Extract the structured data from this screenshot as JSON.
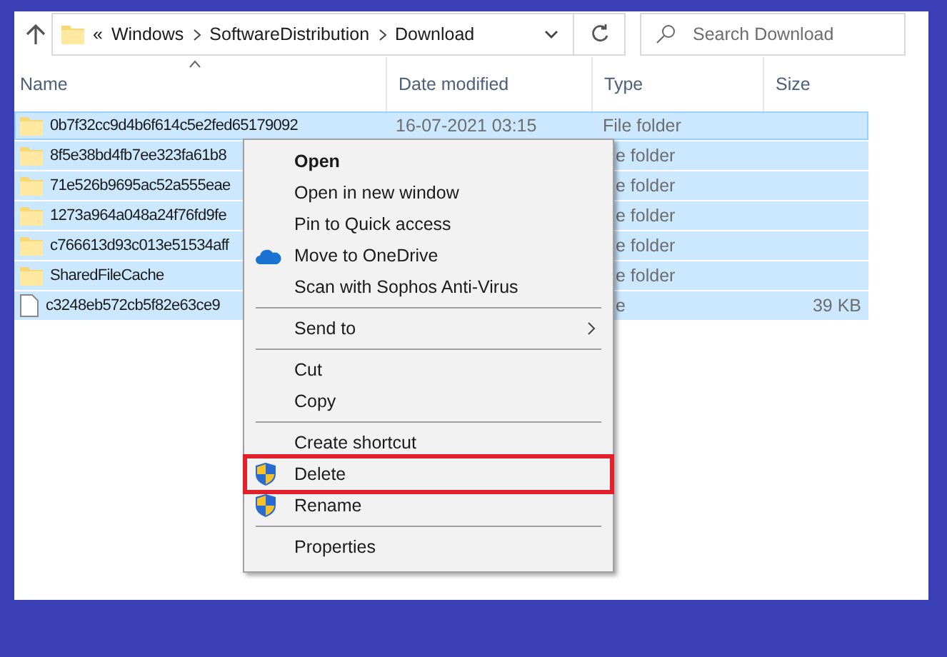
{
  "toolbar": {
    "overflow": "«",
    "breadcrumbs": [
      "Windows",
      "SoftwareDistribution",
      "Download"
    ],
    "search": {
      "placeholder": "Search Download"
    }
  },
  "table": {
    "columns": [
      "Name",
      "Date modified",
      "Type",
      "Size"
    ],
    "rows": [
      {
        "kind": "folder",
        "selected": true,
        "name": "0b7f32cc9d4b6f614c5e2fed65179092",
        "date": "16-07-2021 03:15",
        "type": "File folder",
        "size": ""
      },
      {
        "kind": "folder",
        "selected": true,
        "name": "8f5e38bd4fb7ee323fa61b8",
        "date": "",
        "type": "e folder",
        "size": ""
      },
      {
        "kind": "folder",
        "selected": true,
        "name": "71e526b9695ac52a555eae",
        "date": "",
        "type": "e folder",
        "size": ""
      },
      {
        "kind": "folder",
        "selected": true,
        "name": "1273a964a048a24f76fd9fe",
        "date": "",
        "type": "e folder",
        "size": ""
      },
      {
        "kind": "folder",
        "selected": true,
        "name": "c766613d93c013e51534aff",
        "date": "",
        "type": "e folder",
        "size": ""
      },
      {
        "kind": "folder",
        "selected": true,
        "name": "SharedFileCache",
        "date": "",
        "type": "e folder",
        "size": ""
      },
      {
        "kind": "file",
        "selected": true,
        "name": "c3248eb572cb5f82e63ce9",
        "date": "",
        "type": "e",
        "size": "39 KB"
      }
    ]
  },
  "context_menu": {
    "items": [
      {
        "kind": "default",
        "label": "Open"
      },
      {
        "kind": "item",
        "label": "Open in new window"
      },
      {
        "kind": "item",
        "label": "Pin to Quick access"
      },
      {
        "kind": "cloud",
        "label": "Move to OneDrive"
      },
      {
        "kind": "item",
        "label": "Scan with Sophos Anti-Virus"
      },
      {
        "kind": "separator"
      },
      {
        "kind": "submenu",
        "label": "Send to"
      },
      {
        "kind": "separator"
      },
      {
        "kind": "item",
        "label": "Cut"
      },
      {
        "kind": "item",
        "label": "Copy"
      },
      {
        "kind": "separator"
      },
      {
        "kind": "item",
        "label": "Create shortcut"
      },
      {
        "kind": "shield",
        "label": "Delete",
        "highlighted": true
      },
      {
        "kind": "shield",
        "label": "Rename",
        "highlighted": false
      },
      {
        "kind": "separator"
      },
      {
        "kind": "item",
        "label": "Properties"
      }
    ]
  }
}
